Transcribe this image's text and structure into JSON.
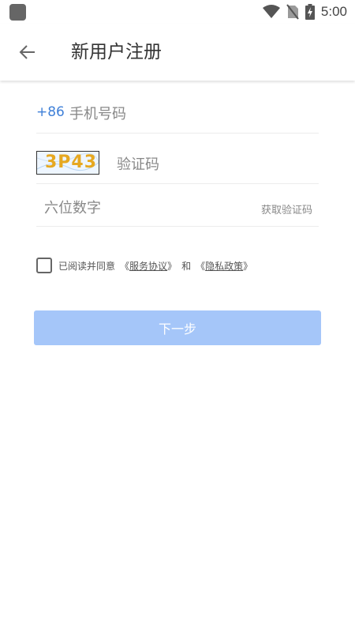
{
  "status_bar": {
    "time": "5:00",
    "icons": [
      "app-icon",
      "wifi-icon",
      "no-sim-icon",
      "battery-charging-icon"
    ]
  },
  "app_bar": {
    "title": "新用户注册",
    "back_icon": "arrow-left-icon"
  },
  "form": {
    "country_code": "+86",
    "phone_placeholder": "手机号码",
    "captcha_text": "3P43",
    "captcha_placeholder": "验证码",
    "sms_code_placeholder": "六位数字",
    "get_code_label": "获取验证码"
  },
  "agreement": {
    "prefix": "已阅读并同意",
    "open_quote_1": "《",
    "service_link": "服务协议",
    "close_quote_1": "》",
    "and": "和",
    "open_quote_2": "《",
    "privacy_link": "隐私政策",
    "close_quote_2": "》"
  },
  "next_button_label": "下一步",
  "colors": {
    "accent": "#3f80d8",
    "button_disabled": "#a5c6f9",
    "divider": "#ececec",
    "text": "#333333",
    "hint": "#888888"
  }
}
